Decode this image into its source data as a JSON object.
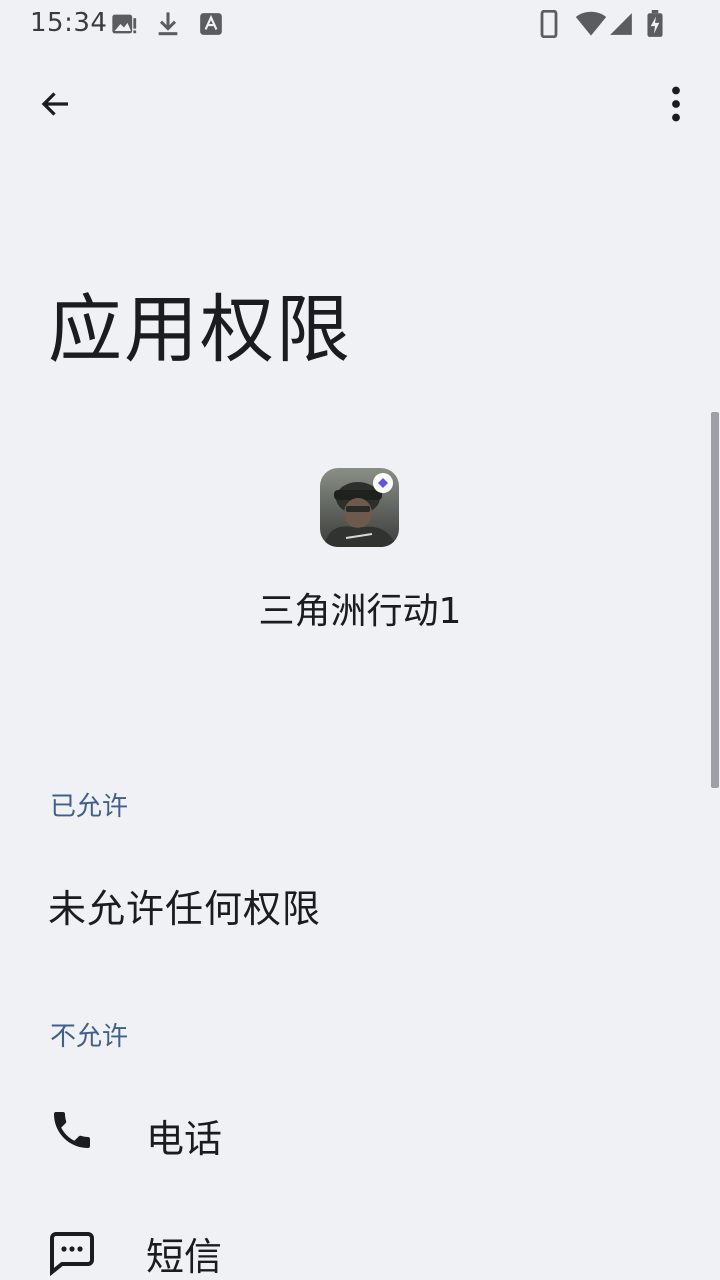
{
  "status_bar": {
    "time": "15:34",
    "left_icons": [
      "gallery-alert-icon",
      "download-icon",
      "text-a-icon"
    ],
    "right_icons": [
      "phone-outline-icon",
      "wifi-icon",
      "signal-icon",
      "battery-charging-icon"
    ]
  },
  "app_bar": {
    "back_icon": "arrow-left-icon",
    "more_icon": "more-vertical-icon"
  },
  "page": {
    "title": "应用权限"
  },
  "app": {
    "name": "三角洲行动1",
    "icon": "soldier-app-icon"
  },
  "sections": {
    "allowed": {
      "header": "已允许",
      "empty_text": "未允许任何权限"
    },
    "denied": {
      "header": "不允许",
      "items": [
        {
          "label": "电话",
          "icon": "phone-icon"
        },
        {
          "label": "短信",
          "icon": "sms-icon"
        }
      ]
    }
  },
  "colors": {
    "background": "#eff1f5",
    "section_header": "#3f5f8f",
    "text_primary": "#1b1c1f"
  }
}
